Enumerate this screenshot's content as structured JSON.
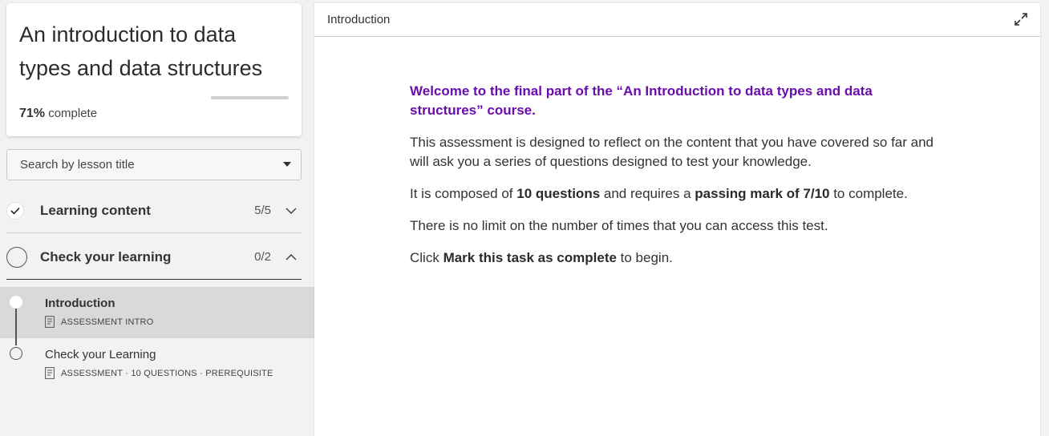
{
  "course": {
    "title": "An introduction to data types and data structures",
    "progress_percent": "71%",
    "progress_suffix": "complete",
    "progress_value": 0.71
  },
  "search": {
    "label": "Search by lesson title"
  },
  "sections": [
    {
      "label": "Learning content",
      "count": "5/5",
      "status": "complete",
      "expanded": false
    },
    {
      "label": "Check your learning",
      "count": "0/2",
      "status": "incomplete",
      "expanded": true
    }
  ],
  "lessons": [
    {
      "title": "Introduction",
      "meta": "ASSESSMENT INTRO",
      "active": true
    },
    {
      "title": "Check your Learning",
      "meta": "ASSESSMENT · 10 QUESTIONS · PREREQUISITE",
      "active": false
    }
  ],
  "panel": {
    "title": "Introduction",
    "welcome": "Welcome to the final part of the “An Introduction to data types and data structures” course.",
    "para1": "This assessment is designed to reflect on the content that you have covered so far and will ask you a series of questions designed to test your knowledge.",
    "para2": {
      "before": "It is composed of ",
      "bold1": "10 questions",
      "middle": " and requires a ",
      "bold2": "passing mark of 7/10",
      "after": " to complete."
    },
    "para3": "There is no limit on the number of times that you can access this test.",
    "para4": {
      "before": "Click ",
      "bold": "Mark this task as complete",
      "after": " to begin."
    }
  },
  "colors": {
    "accent_purple": "#6a0dad",
    "sidebar_bg": "#f2f2f2",
    "active_lesson_bg": "#d9d9d9"
  },
  "icons": {
    "section_complete": "check-icon",
    "section_incomplete": "circle-icon",
    "collapsed": "chevron-down-icon",
    "expanded": "chevron-up-icon",
    "lesson_type": "document-icon",
    "expand": "expand-icon"
  }
}
